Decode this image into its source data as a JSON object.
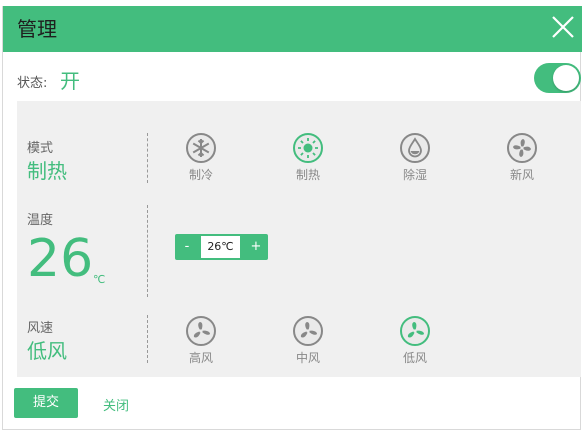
{
  "dialog": {
    "title": "管理"
  },
  "status": {
    "label": "状态:",
    "value": "开",
    "toggle_on": true
  },
  "mode": {
    "label": "模式",
    "value": "制热",
    "options": [
      {
        "label": "制冷",
        "icon": "snowflake-icon",
        "active": false
      },
      {
        "label": "制热",
        "icon": "sun-icon",
        "active": true
      },
      {
        "label": "除湿",
        "icon": "water-drop-icon",
        "active": false
      },
      {
        "label": "新风",
        "icon": "fan-icon",
        "active": false
      }
    ]
  },
  "temperature": {
    "label": "温度",
    "value": "26",
    "unit": "℃",
    "stepper": {
      "minus": "-",
      "value": "26℃",
      "plus": "+"
    }
  },
  "fan_speed": {
    "label": "风速",
    "value": "低风",
    "options": [
      {
        "label": "高风",
        "icon": "fan-icon",
        "active": false
      },
      {
        "label": "中风",
        "icon": "fan-icon",
        "active": false
      },
      {
        "label": "低风",
        "icon": "fan-icon",
        "active": true
      }
    ]
  },
  "footer": {
    "submit_label": "提交",
    "close_label": "关闭"
  },
  "colors": {
    "accent": "#43bd7e",
    "panel_bg": "#f0f0f0",
    "icon_gray": "#888888"
  }
}
